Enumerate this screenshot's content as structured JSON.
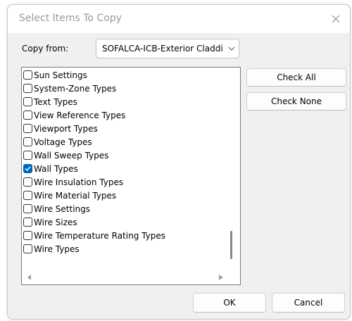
{
  "dialog": {
    "title": "Select Items To Copy",
    "close_icon": "close-icon"
  },
  "copy_from": {
    "label": "Copy from:",
    "selected": "SOFALCA-ICB-Exterior Claddi",
    "chevron_icon": "chevron-down-icon"
  },
  "list": {
    "items": [
      {
        "label": "Sun Settings",
        "checked": false
      },
      {
        "label": "System-Zone Types",
        "checked": false
      },
      {
        "label": "Text Types",
        "checked": false
      },
      {
        "label": "View Reference Types",
        "checked": false
      },
      {
        "label": "Viewport Types",
        "checked": false
      },
      {
        "label": "Voltage Types",
        "checked": false
      },
      {
        "label": "Wall Sweep Types",
        "checked": false
      },
      {
        "label": "Wall Types",
        "checked": true
      },
      {
        "label": "Wire Insulation Types",
        "checked": false
      },
      {
        "label": "Wire Material Types",
        "checked": false
      },
      {
        "label": "Wire Settings",
        "checked": false
      },
      {
        "label": "Wire Sizes",
        "checked": false
      },
      {
        "label": "Wire Temperature Rating Types",
        "checked": false
      },
      {
        "label": "Wire Types",
        "checked": false
      }
    ]
  },
  "buttons": {
    "check_all": "Check All",
    "check_none": "Check None",
    "ok": "OK",
    "cancel": "Cancel"
  },
  "colors": {
    "accent": "#0067c0",
    "dialog_bg": "#f0f0f0",
    "title_text": "#9a9a9a"
  }
}
